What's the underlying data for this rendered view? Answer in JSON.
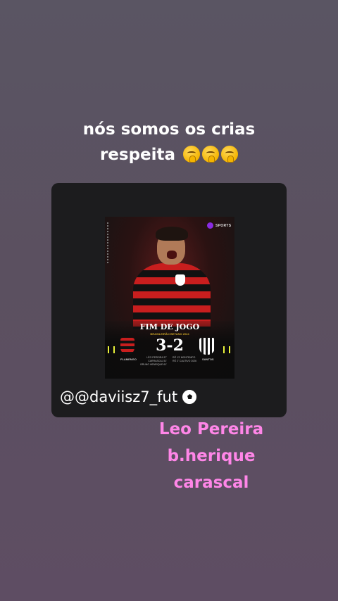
{
  "caption": {
    "line1": "nós somos os crias",
    "line2": "respeita",
    "emoji_icon": "shushing-face-emoji",
    "emoji_count": 3
  },
  "post": {
    "brand": "SPORTS",
    "headline": "FIM DE JOGO",
    "competition": "BRASILEIRÃO BETANO 2024",
    "score": "3-2",
    "home_team": "FLAMENGO",
    "away_team": "SANTOS",
    "home_scorers": [
      "LÉO PEREIRA 37'",
      "CARRASCAL 51'",
      "BRUNO HENRIQUE 61'"
    ],
    "away_scorers": [
      "RÔ 13' MONTEMPO",
      "RÔ 2' CAUTIVO 2026"
    ],
    "handle": "@@daviisz7_fut",
    "handle_icon": "soccer-ball-icon"
  },
  "names": [
    "Leo Pereira",
    "b.herique",
    "carascal"
  ],
  "colors": {
    "names": "#ff86e8",
    "caption": "#ffffff",
    "accent_red": "#c81e1e"
  }
}
